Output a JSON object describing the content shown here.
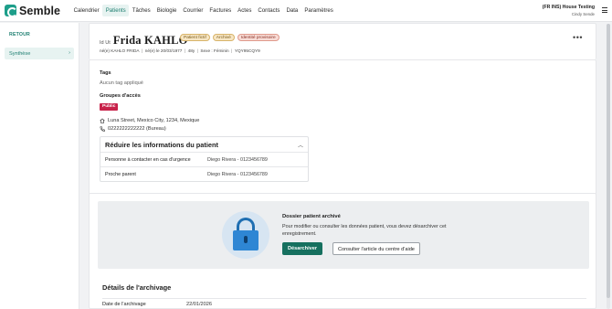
{
  "app": {
    "name": "Semble"
  },
  "nav": [
    "Calendrier",
    "Patients",
    "Tâches",
    "Biologie",
    "Courrier",
    "Factures",
    "Actes",
    "Contacts",
    "Data",
    "Paramètres"
  ],
  "nav_active": "Patients",
  "user": {
    "site": "(FR INS) House Testing",
    "name": "Cindy Sende"
  },
  "sidebar": {
    "back": "RETOUR",
    "items": [
      {
        "label": "Synthèse"
      }
    ]
  },
  "patient": {
    "id_label": "Id Ut",
    "name": "Frida KAHLO",
    "badges": [
      "Patient fictif",
      "Archivé",
      "Identité provisoire"
    ],
    "meta": [
      "né(e) KAHLO FRIDA",
      "né(e) le 20/03/1977",
      "48y",
      "Sexe : Féminin",
      "YQY95CQY9"
    ]
  },
  "tags": {
    "label": "Tags",
    "empty": "Aucun tag appliqué"
  },
  "access_groups": {
    "label": "Groupes d'accès",
    "badge": "Public"
  },
  "address": "Luna Street, Mexico City, 1234, Mexique",
  "phone": "0222222222222 (Bureau)",
  "reduce": {
    "title": "Réduire les informations du patient",
    "rows": [
      {
        "key": "Personne à contacter en cas d'urgence",
        "value": "Diego Rivera - 0123456789"
      },
      {
        "key": "Proche parent",
        "value": "Diego Rivera - 0123456789"
      }
    ]
  },
  "archive": {
    "title": "Dossier patient archivé",
    "description": "Pour modifier ou consulter les données patient, vous devez désarchiver cet enregistrement.",
    "primary_button": "Désarchiver",
    "secondary_button": "Consulter l'article du centre d'aide"
  },
  "archive_details": {
    "title": "Détails de l'archivage",
    "rows": [
      {
        "key": "Date de l'archivage",
        "value": "22/01/2026"
      }
    ]
  },
  "colors": {
    "brand": "#1d9e8a",
    "primary_button": "#16705f",
    "public_badge": "#c8224a"
  }
}
